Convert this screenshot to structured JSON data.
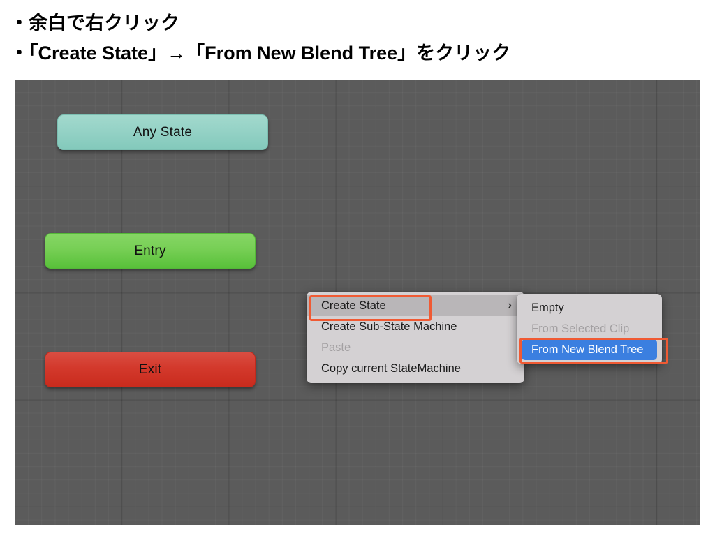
{
  "instructions": {
    "line1": "・余白で右クリック",
    "line2": "・「Create State」→「From New Blend Tree」をクリック"
  },
  "canvas": {
    "background_color": "#5b5b5b",
    "nodes": [
      {
        "id": "any-state",
        "label": "Any State",
        "color": "#95d2c6",
        "type": "special-state"
      },
      {
        "id": "entry",
        "label": "Entry",
        "color": "#77cf55",
        "type": "entry-state"
      },
      {
        "id": "exit",
        "label": "Exit",
        "color": "#d3392c",
        "type": "exit-state"
      }
    ]
  },
  "context_menu": {
    "items": [
      {
        "label": "Create State",
        "state": "hovered",
        "has_submenu": true,
        "arrow": "›"
      },
      {
        "label": "Create Sub-State Machine",
        "state": "normal",
        "has_submenu": false,
        "arrow": ""
      },
      {
        "label": "Paste",
        "state": "disabled",
        "has_submenu": false,
        "arrow": ""
      },
      {
        "label": "Copy current StateMachine",
        "state": "normal",
        "has_submenu": false,
        "arrow": ""
      }
    ],
    "background_color": "#d4d1d3",
    "hover_color": "#b9b6b8"
  },
  "submenu": {
    "items": [
      {
        "label": "Empty",
        "state": "normal"
      },
      {
        "label": "From Selected Clip",
        "state": "disabled"
      },
      {
        "label": "From New Blend Tree",
        "state": "selected"
      }
    ],
    "background_color": "#d4d1d3",
    "selection_color": "#3b7fe0"
  },
  "annotations": {
    "highlight_color": "#f05a33",
    "boxes": [
      {
        "target": "Create State"
      },
      {
        "target": "From New Blend Tree"
      }
    ]
  }
}
